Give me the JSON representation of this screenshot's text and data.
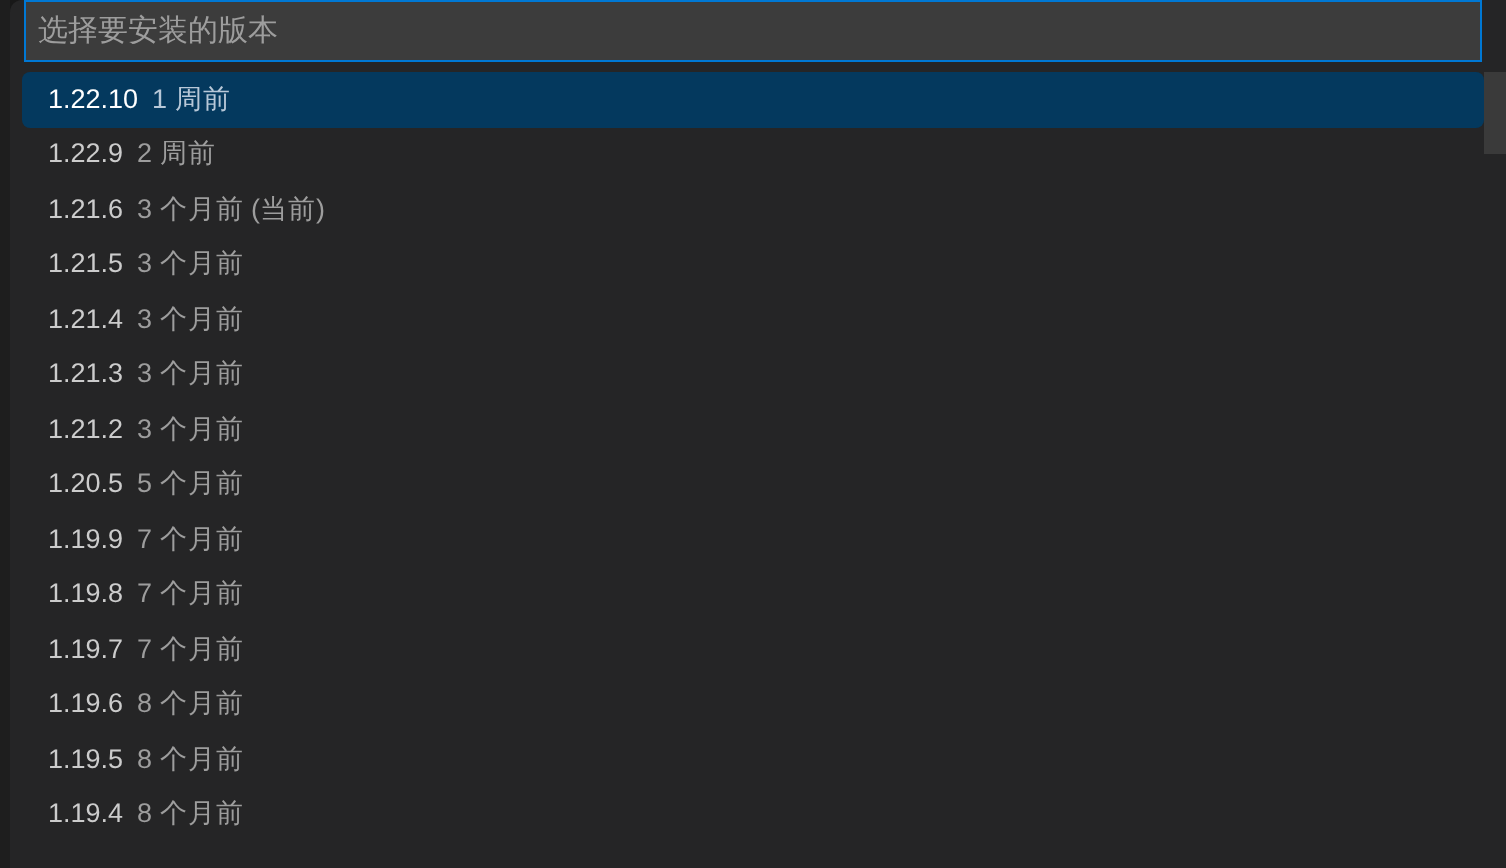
{
  "search": {
    "placeholder": "选择要安装的版本"
  },
  "items": [
    {
      "version": "1.22.10",
      "detail": "1 周前",
      "selected": true
    },
    {
      "version": "1.22.9",
      "detail": "2 周前",
      "selected": false
    },
    {
      "version": "1.21.6",
      "detail": "3 个月前 (当前)",
      "selected": false
    },
    {
      "version": "1.21.5",
      "detail": "3 个月前",
      "selected": false
    },
    {
      "version": "1.21.4",
      "detail": "3 个月前",
      "selected": false
    },
    {
      "version": "1.21.3",
      "detail": "3 个月前",
      "selected": false
    },
    {
      "version": "1.21.2",
      "detail": "3 个月前",
      "selected": false
    },
    {
      "version": "1.20.5",
      "detail": "5 个月前",
      "selected": false
    },
    {
      "version": "1.19.9",
      "detail": "7 个月前",
      "selected": false
    },
    {
      "version": "1.19.8",
      "detail": "7 个月前",
      "selected": false
    },
    {
      "version": "1.19.7",
      "detail": "7 个月前",
      "selected": false
    },
    {
      "version": "1.19.6",
      "detail": "8 个月前",
      "selected": false
    },
    {
      "version": "1.19.5",
      "detail": "8 个月前",
      "selected": false
    },
    {
      "version": "1.19.4",
      "detail": "8 个月前",
      "selected": false
    }
  ]
}
